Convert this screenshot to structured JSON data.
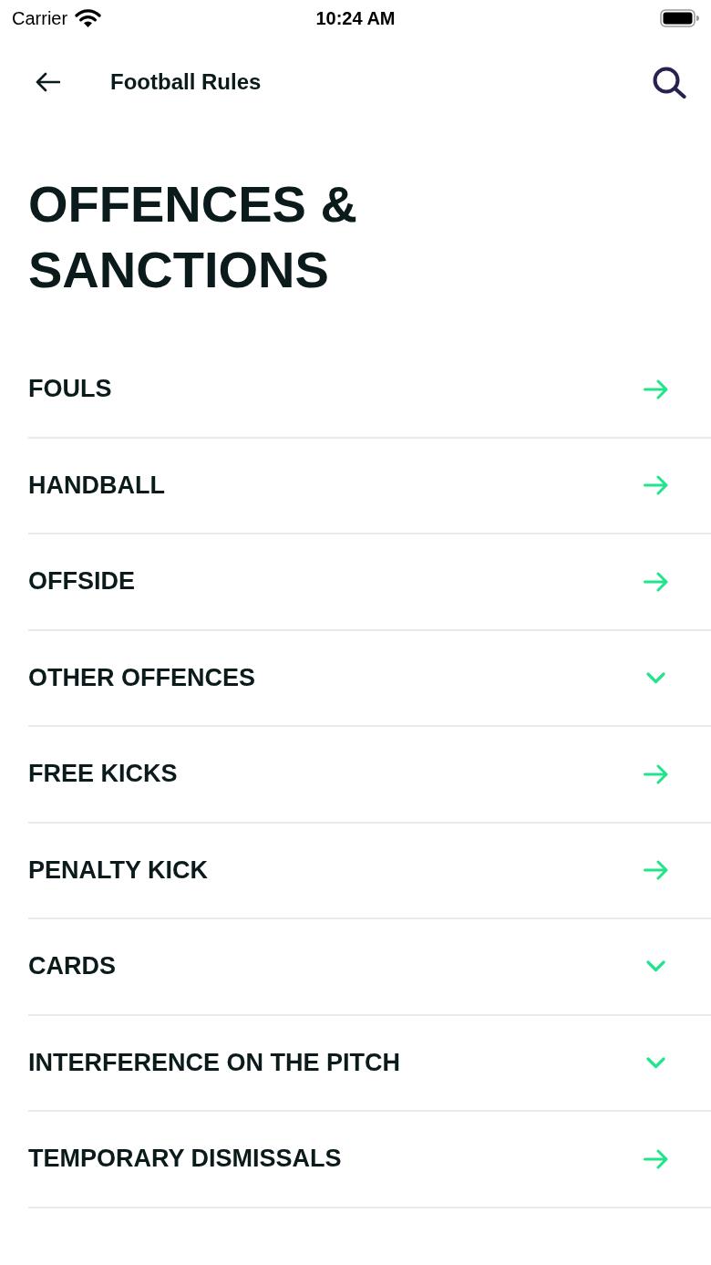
{
  "status_bar": {
    "carrier": "Carrier",
    "time": "10:24 AM"
  },
  "header": {
    "title": "Football Rules"
  },
  "page_title": "OFFENCES & SANCTIONS",
  "items": [
    {
      "label": "FOULS",
      "kind": "link"
    },
    {
      "label": "HANDBALL",
      "kind": "link"
    },
    {
      "label": "OFFSIDE",
      "kind": "link"
    },
    {
      "label": "OTHER OFFENCES",
      "kind": "group"
    },
    {
      "label": "FREE KICKS",
      "kind": "link"
    },
    {
      "label": "PENALTY KICK",
      "kind": "link"
    },
    {
      "label": "CARDS",
      "kind": "group"
    },
    {
      "label": "INTERFERENCE ON THE PITCH",
      "kind": "group"
    },
    {
      "label": "TEMPORARY DISMISSALS",
      "kind": "link"
    }
  ]
}
